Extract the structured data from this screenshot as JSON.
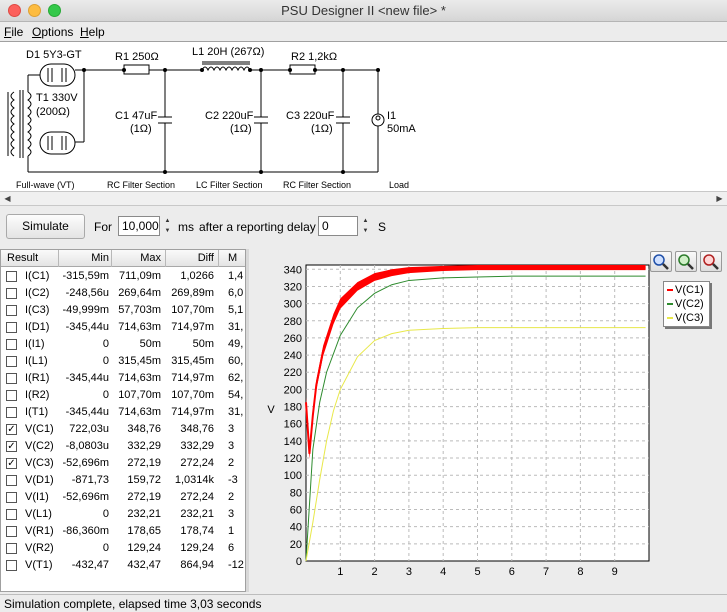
{
  "window": {
    "title": "PSU Designer II  <new file> *"
  },
  "menu": [
    {
      "u": "F",
      "rest": "ile"
    },
    {
      "u": "O",
      "rest": "ptions"
    },
    {
      "u": "H",
      "rest": "elp"
    }
  ],
  "schematic": {
    "d1": "D1 5Y3-GT",
    "t1": "T1 330V",
    "t1_ohm": "(200Ω)",
    "r1": "R1 250Ω",
    "l1": "L1 20H (267Ω)",
    "r2": "R2 1,2kΩ",
    "c1": "C1 47uF",
    "c1_esr": "(1Ω)",
    "c2": "C2 220uF",
    "c2_esr": "(1Ω)",
    "c3": "C3 220uF",
    "c3_esr": "(1Ω)",
    "i1": "I1",
    "i1_val": "50mA",
    "sec_fullwave": "Full-wave (VT)",
    "sec_rc1": "RC Filter Section",
    "sec_lc": "LC Filter Section",
    "sec_rc2": "RC Filter Section",
    "sec_load": "Load"
  },
  "toolbar": {
    "simulate": "Simulate",
    "for_label": "For",
    "duration": "10,000",
    "ms_label": "ms",
    "delay_label": "after a reporting delay of",
    "delay": "0",
    "s_label": "S"
  },
  "table": {
    "headers": [
      "Result",
      "Min",
      "Max",
      "Diff",
      "M"
    ],
    "rows": [
      {
        "checked": false,
        "name": "I(C1)",
        "min": "-315,59m",
        "max": "711,09m",
        "diff": "1,0266",
        "m": "1,4"
      },
      {
        "checked": false,
        "name": "I(C2)",
        "min": "-248,56u",
        "max": "269,64m",
        "diff": "269,89m",
        "m": "6,0"
      },
      {
        "checked": false,
        "name": "I(C3)",
        "min": "-49,999m",
        "max": "57,703m",
        "diff": "107,70m",
        "m": "5,1"
      },
      {
        "checked": false,
        "name": "I(D1)",
        "min": "-345,44u",
        "max": "714,63m",
        "diff": "714,97m",
        "m": "31,"
      },
      {
        "checked": false,
        "name": "I(I1)",
        "min": "0",
        "max": "50m",
        "diff": "50m",
        "m": "49,"
      },
      {
        "checked": false,
        "name": "I(L1)",
        "min": "0",
        "max": "315,45m",
        "diff": "315,45m",
        "m": "60,"
      },
      {
        "checked": false,
        "name": "I(R1)",
        "min": "-345,44u",
        "max": "714,63m",
        "diff": "714,97m",
        "m": "62,"
      },
      {
        "checked": false,
        "name": "I(R2)",
        "min": "0",
        "max": "107,70m",
        "diff": "107,70m",
        "m": "54,"
      },
      {
        "checked": false,
        "name": "I(T1)",
        "min": "-345,44u",
        "max": "714,63m",
        "diff": "714,97m",
        "m": "31,"
      },
      {
        "checked": true,
        "name": "V(C1)",
        "min": "722,03u",
        "max": "348,76",
        "diff": "348,76",
        "m": "3"
      },
      {
        "checked": true,
        "name": "V(C2)",
        "min": "-8,0803u",
        "max": "332,29",
        "diff": "332,29",
        "m": "3"
      },
      {
        "checked": true,
        "name": "V(C3)",
        "min": "-52,696m",
        "max": "272,19",
        "diff": "272,24",
        "m": "2"
      },
      {
        "checked": false,
        "name": "V(D1)",
        "min": "-871,73",
        "max": "159,72",
        "diff": "1,0314k",
        "m": "-3"
      },
      {
        "checked": false,
        "name": "V(I1)",
        "min": "-52,696m",
        "max": "272,19",
        "diff": "272,24",
        "m": "2"
      },
      {
        "checked": false,
        "name": "V(L1)",
        "min": "0",
        "max": "232,21",
        "diff": "232,21",
        "m": "3"
      },
      {
        "checked": false,
        "name": "V(R1)",
        "min": "-86,360m",
        "max": "178,65",
        "diff": "178,74",
        "m": "1"
      },
      {
        "checked": false,
        "name": "V(R2)",
        "min": "0",
        "max": "129,24",
        "diff": "129,24",
        "m": "6"
      },
      {
        "checked": false,
        "name": "V(T1)",
        "min": "-432,47",
        "max": "432,47",
        "diff": "864,94",
        "m": "-12"
      }
    ]
  },
  "status": "Simulation complete, elapsed time 3,03 seconds",
  "icons": [
    "zoom-in-icon",
    "zoom-fit-icon",
    "zoom-out-icon"
  ],
  "chart_data": {
    "type": "line",
    "ylabel": "V",
    "xlim": [
      0,
      10
    ],
    "ylim": [
      0,
      345
    ],
    "xticks": [
      1,
      2,
      3,
      4,
      5,
      6,
      7,
      8,
      9
    ],
    "yticks": [
      0,
      20,
      40,
      60,
      80,
      100,
      120,
      140,
      160,
      180,
      200,
      220,
      240,
      260,
      280,
      300,
      320,
      340
    ],
    "grid": true,
    "legend": "top-right",
    "series": [
      {
        "name": "V(C1)",
        "color": "#ff0000",
        "x": [
          0,
          0.1,
          0.2,
          0.3,
          0.5,
          0.8,
          1.0,
          1.5,
          2.0,
          2.5,
          3.0,
          4.0,
          5.0,
          6.0,
          7.0,
          8.0,
          9.0,
          9.9
        ],
        "y": [
          185,
          125,
          170,
          205,
          245,
          282,
          300,
          320,
          331,
          336,
          339,
          341,
          342,
          342,
          342,
          342,
          342,
          342
        ],
        "band": [
          12,
          12,
          12,
          12,
          12,
          12,
          12,
          10,
          9,
          8,
          7,
          6,
          6,
          6,
          6,
          6,
          6,
          6
        ]
      },
      {
        "name": "V(C2)",
        "color": "#2e8b2e",
        "x": [
          0,
          0.2,
          0.4,
          0.6,
          1.0,
          1.5,
          2.0,
          2.5,
          3.0,
          4.0,
          5.0,
          6.0,
          7.0,
          8.0,
          9.0,
          9.9
        ],
        "y": [
          0,
          130,
          185,
          220,
          263,
          295,
          312,
          322,
          327,
          330,
          331,
          332,
          332,
          332,
          332,
          332
        ]
      },
      {
        "name": "V(C3)",
        "color": "#e8e84a",
        "x": [
          0,
          0.2,
          0.4,
          0.6,
          0.8,
          1.0,
          1.5,
          2.0,
          2.5,
          3.0,
          4.0,
          5.0,
          6.0,
          7.0,
          8.0,
          9.0,
          9.9
        ],
        "y": [
          0,
          45,
          95,
          140,
          175,
          200,
          238,
          257,
          265,
          269,
          271,
          272,
          272,
          272,
          272,
          272,
          272
        ]
      }
    ]
  }
}
